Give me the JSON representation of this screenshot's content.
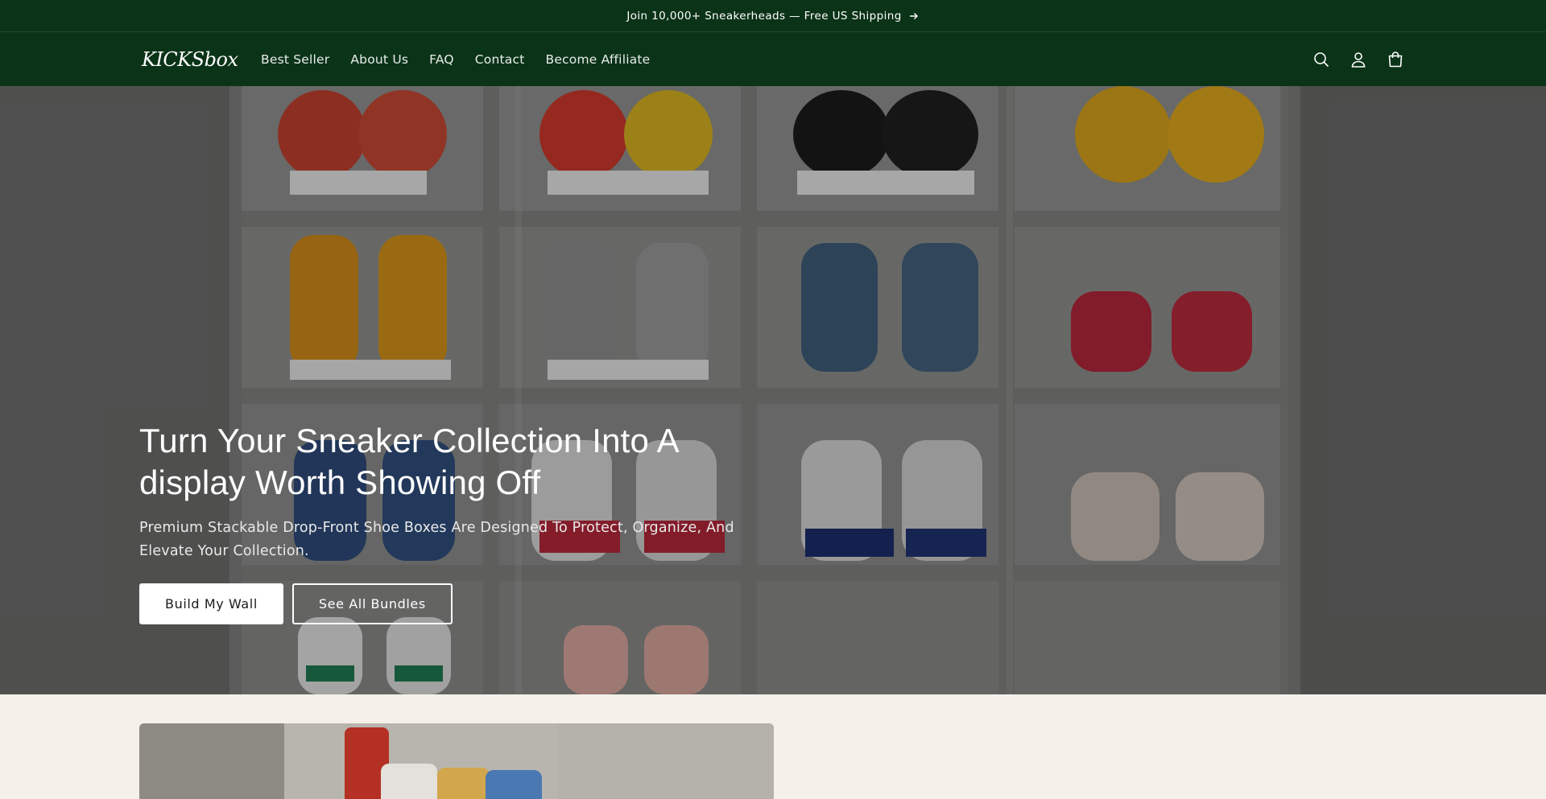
{
  "announcement": {
    "text": "Join 10,000+ Sneakerheads — Free US Shipping",
    "icon": "arrow-right-icon"
  },
  "header": {
    "logo": "KICKSbox",
    "nav": [
      "Best Seller",
      "About Us",
      "FAQ",
      "Contact",
      "Become Affiliate"
    ],
    "icons": [
      "search-icon",
      "account-icon",
      "cart-icon"
    ]
  },
  "hero": {
    "title": "Turn Your Sneaker Collection Into A display Worth Showing Off",
    "subtitle": "Premium Stackable Drop-Front Shoe Boxes Are Designed To Protect, Organize, And Elevate Your Collection.",
    "primary_button": "Build My Wall",
    "secondary_button": "See All Bundles"
  },
  "colors": {
    "header_bg": "#0b3318",
    "page_bg": "#f5f1ea",
    "button_bg": "#ffffff"
  }
}
